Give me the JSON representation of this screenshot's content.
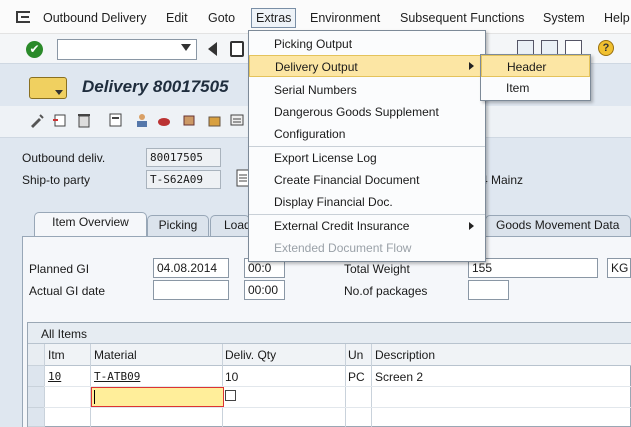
{
  "menubar": {
    "items": [
      "Outbound Delivery",
      "Edit",
      "Goto",
      "Extras",
      "Environment",
      "Subsequent Functions",
      "System",
      "Help"
    ]
  },
  "title": "Delivery 80017505",
  "header": {
    "outbound_deliv_label": "Outbound deliv.",
    "outbound_deliv_value": "80017505",
    "ship_to_label": "Ship-to party",
    "ship_to_value": "T-S62A09",
    "ship_to_address": "4 Mainz"
  },
  "tabs": [
    "Item Overview",
    "Picking",
    "Load",
    "Goods Movement Data"
  ],
  "fields": {
    "planned_gi_label": "Planned GI",
    "planned_gi_date": "04.08.2014",
    "planned_gi_time": "00:0",
    "actual_gi_label": "Actual GI date",
    "actual_gi_date": "",
    "actual_gi_time": "00:00",
    "total_weight_label": "Total Weight",
    "total_weight_value": "155",
    "weight_unit": "KG",
    "packages_label": "No.of packages",
    "packages_value": ""
  },
  "table": {
    "title": "All Items",
    "columns": [
      "Itm",
      "Material",
      "Deliv. Qty",
      "Un",
      "Description"
    ],
    "rows": [
      {
        "itm": "10",
        "material": "T-ATB09",
        "qty": "10",
        "un": "PC",
        "description": "Screen 2"
      }
    ]
  },
  "extras_menu": {
    "items": [
      {
        "label": "Picking Output",
        "state": "normal",
        "submenu": false
      },
      {
        "label": "Delivery Output",
        "state": "highlighted",
        "submenu": true
      },
      {
        "label": "Serial Numbers",
        "state": "normal",
        "submenu": false
      },
      {
        "label": "Dangerous Goods Supplement",
        "state": "normal",
        "submenu": false
      },
      {
        "label": "Configuration",
        "state": "normal",
        "submenu": false
      },
      {
        "label": "Export License Log",
        "state": "normal",
        "submenu": false
      },
      {
        "label": "Create Financial Document",
        "state": "normal",
        "submenu": false
      },
      {
        "label": "Display Financial Doc.",
        "state": "normal",
        "submenu": false
      },
      {
        "label": "External Credit Insurance",
        "state": "normal",
        "submenu": true
      },
      {
        "label": "Extended Document Flow",
        "state": "disabled",
        "submenu": false
      }
    ]
  },
  "submenu": {
    "items": [
      {
        "label": "Header",
        "state": "highlighted"
      },
      {
        "label": "Item",
        "state": "normal"
      }
    ]
  },
  "colors": {
    "highlight": "#fce6a4",
    "background": "#dfe7f0",
    "edit_cell": "#ffee9a"
  }
}
